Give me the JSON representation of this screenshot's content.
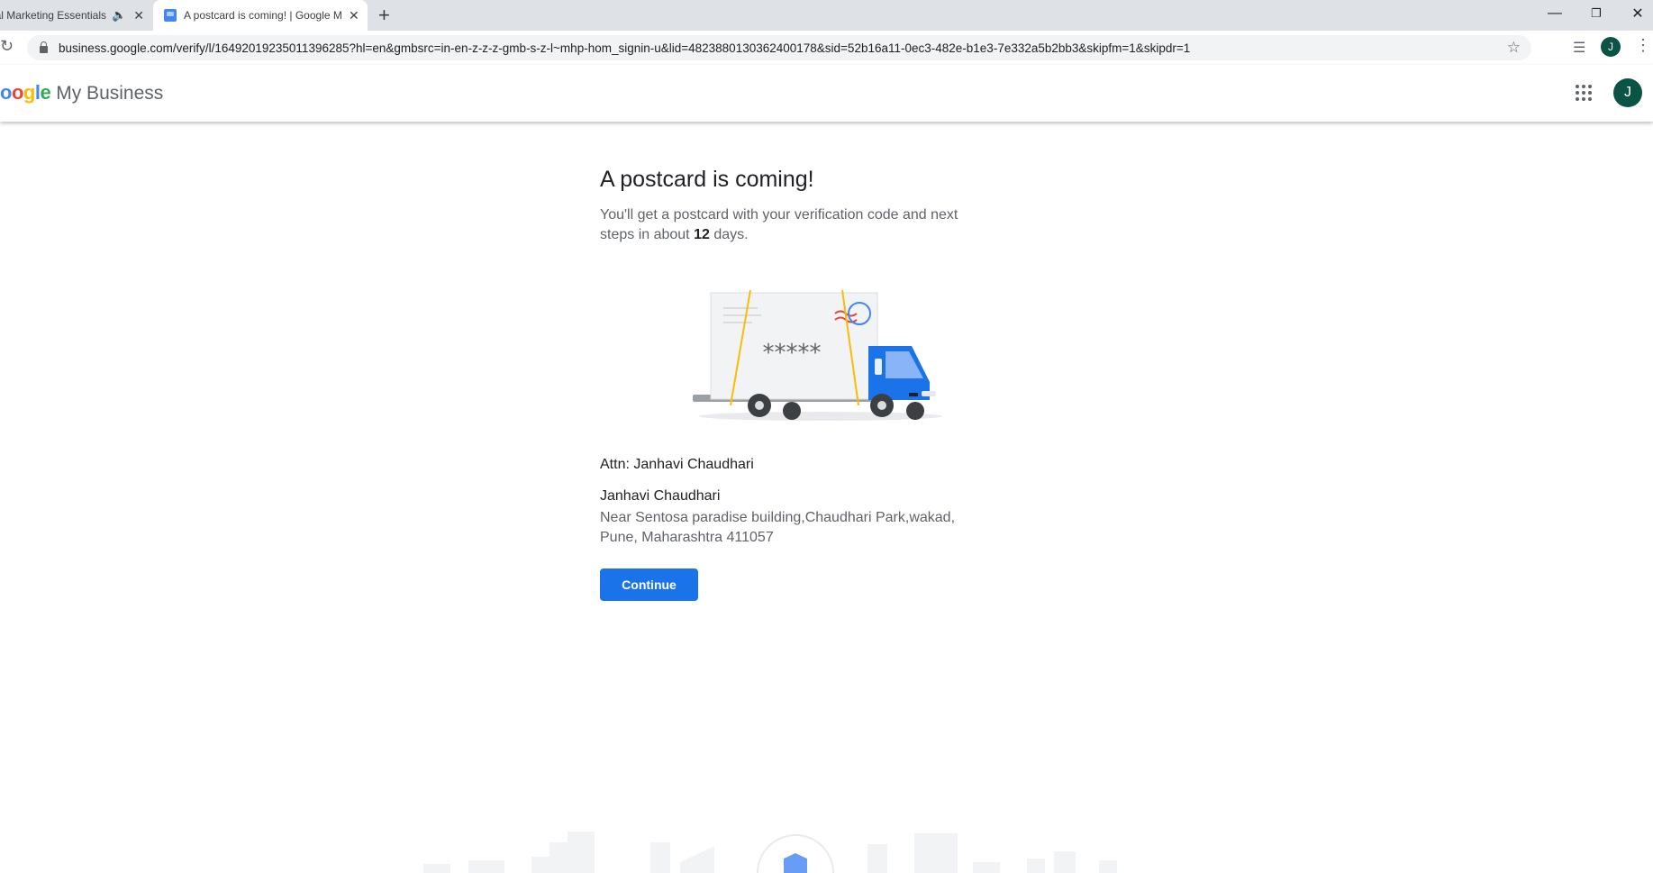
{
  "browser": {
    "tabs": [
      {
        "title": "Digital Marketing Essentials"
      },
      {
        "title": "A postcard is coming! | Google My Business"
      }
    ],
    "url": "business.google.com/verify/l/16492019235011396285?hl=en&gmbsrc=in-en-z-z-z-gmb-s-z-l~mhp-hom_signin-u&lid=4823880130362400178&sid=52b16a11-0ec3-482e-b1e3-7e332a5b2bb3&skipfm=1&skipdr=1",
    "profile_initial": "J"
  },
  "app": {
    "brand_google": "oogle",
    "brand_product": "My Business",
    "avatar_initial": "J"
  },
  "main": {
    "heading": "A postcard is coming!",
    "desc_before": "You'll get a postcard with your verification code and next steps in about ",
    "days": "12",
    "desc_after": " days.",
    "postcard_code": "*****",
    "attn": "Attn: Janhavi Chaudhari",
    "recipient_name": "Janhavi Chaudhari",
    "address": "Near Sentosa paradise building,Chaudhari Park,wakad, Pune, Maharashtra 411057",
    "continue_label": "Continue"
  },
  "colors": {
    "primary": "#1a73e8",
    "avatar_bg": "#0b5345"
  }
}
